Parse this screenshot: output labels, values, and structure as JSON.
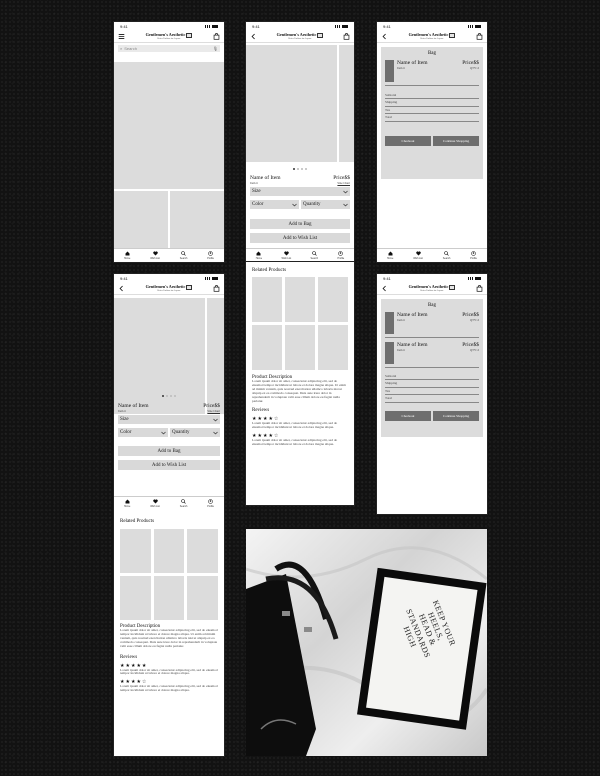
{
  "status": {
    "time": "9:41"
  },
  "brand": {
    "name": "Gentlemen's Aesthetic",
    "tagline": "Better Fashion for Anyone"
  },
  "search": {
    "placeholder": "Search"
  },
  "tabs": [
    {
      "label": "Home",
      "icon": "home-icon"
    },
    {
      "label": "Wish List",
      "icon": "heart-icon"
    },
    {
      "label": "Search",
      "icon": "search-icon"
    },
    {
      "label": "Profile",
      "icon": "profile-icon"
    }
  ],
  "product": {
    "name": "Name of Item",
    "price": "Price$$",
    "item_no": "Item #",
    "size_chart": "Size Chart",
    "size_label": "Size",
    "color_label": "Color",
    "quantity_label": "Quantity",
    "add_to_bag": "Add to Bag",
    "add_to_wishlist": "Add to Wish List",
    "related_heading": "Related Products",
    "description_heading": "Product Description",
    "description_text": "Lorem ipsum dolor sit amet, consectetur adipiscing elit, sed do eiusmod tempor incididunt ut labore et dolore magna aliqua. Ut enim ad minim veniam, quis nostrud exercitation ullamco laboris nisi ut aliquip ex ea commodo consequat. Duis aute irure dolor in reprehenderit in voluptate velit esse cillum dolore eu fugiat nulla pariatur.",
    "reviews_heading": "Reviews",
    "review_1_stars": "★★★★☆",
    "review_1_text": "Lorem ipsum dolor sit amet, consectetur adipiscing elit, sed do eiusmod tempor incididunt ut labore et dolore magna aliqua.",
    "review_2_stars": "★★★★☆",
    "review_2_text": "Lorem ipsum dolor sit amet, consectetur adipiscing elit, sed do eiusmod tempor incididunt ut labore et dolore magna aliqua.",
    "review_1_stars_long": "★★★★★"
  },
  "bag": {
    "title": "Bag",
    "item_name": "Name of Item",
    "item_price": "Price$$",
    "item_no": "Item #",
    "qty": "QTY: #",
    "subtotal": "Subtotal",
    "shipping": "Shipping",
    "tax": "Tax",
    "total": "Total",
    "checkout": "Checkout",
    "continue": "Continue Shopping"
  },
  "poster": {
    "text": "KEEP YOUR HEELS, HEAD & STANDARDS HIGH"
  }
}
